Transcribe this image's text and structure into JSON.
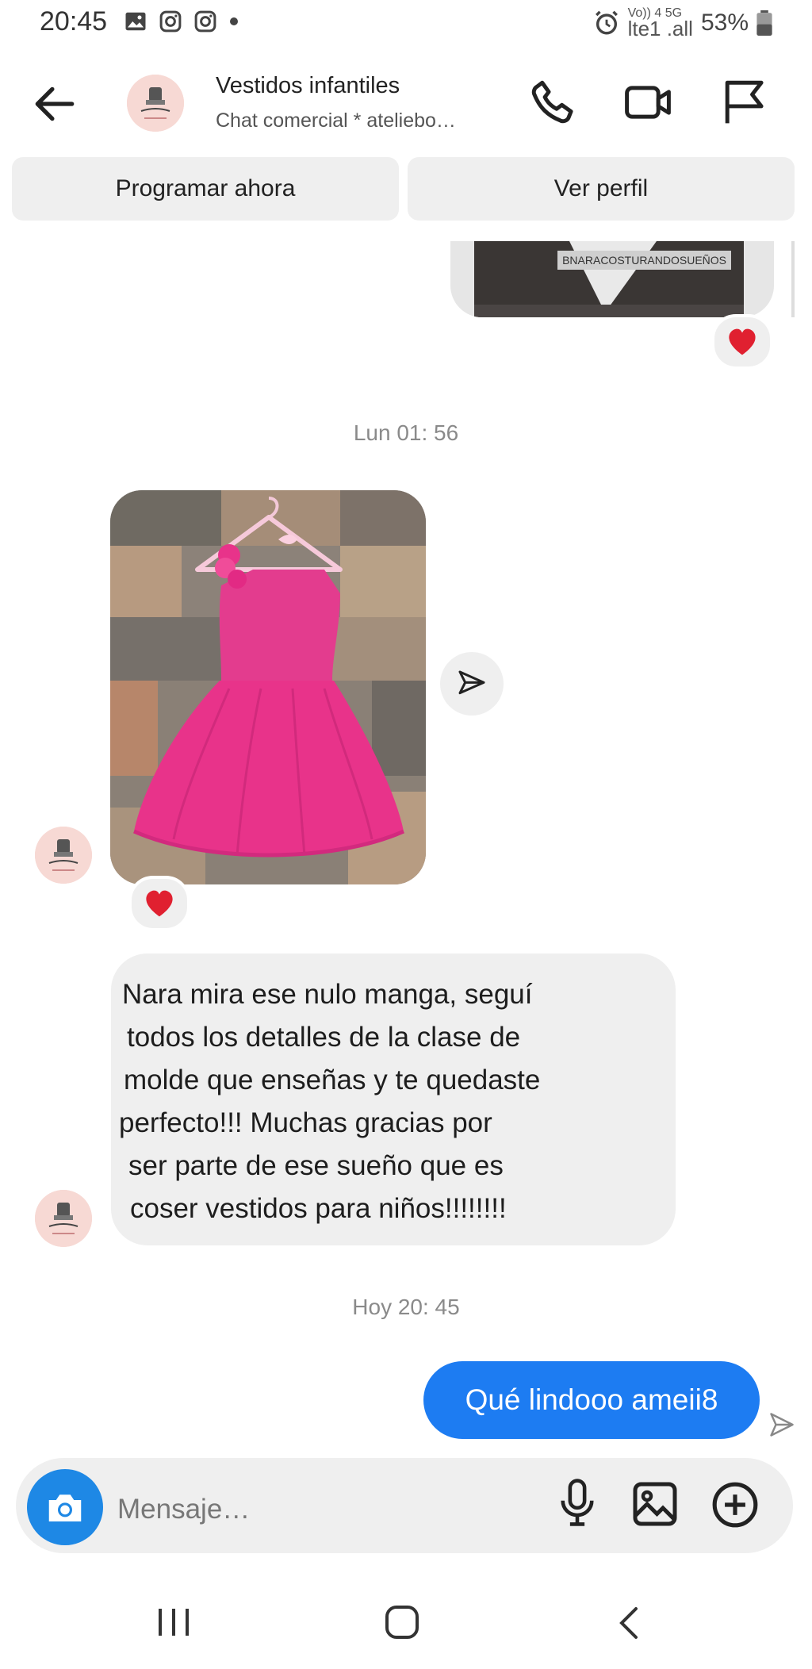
{
  "status_bar": {
    "time": "20:45",
    "network": "Vo)) 4 5G",
    "network_sub": "lte1 .all",
    "battery": "53%"
  },
  "header": {
    "title": "Vestidos infantiles",
    "subtitle": "Chat comercial * ateliebo…",
    "icons": [
      "back-arrow-icon",
      "phone-icon",
      "video-icon",
      "flag-icon"
    ]
  },
  "actions": {
    "schedule_label": "Programar ahora",
    "profile_label": "Ver perfil"
  },
  "chat": {
    "shared_image_watermark": "BNARACOSTURANDOSUEÑOS",
    "timestamp_1": "Lun 01: 56",
    "message_lines": [
      "Nara mira ese nulo manga, seguí",
      "todos los detalles de la clase de",
      "molde que enseñas y te quedaste",
      "perfecto!!! Muchas gracias por",
      "ser parte de ese sueño que es",
      "coser vestidos para niños!!!!!!!!"
    ],
    "timestamp_2": "Hoy 20: 45",
    "sent_message": "Qué lindooo ameii8"
  },
  "composer": {
    "placeholder": "Mensaje…"
  },
  "colors": {
    "accent": "#1d7cf2",
    "camera_button": "#1e88e5",
    "bubble_gray": "#efefef",
    "heart": "#e02030",
    "dress_pink": "#e8308a"
  }
}
